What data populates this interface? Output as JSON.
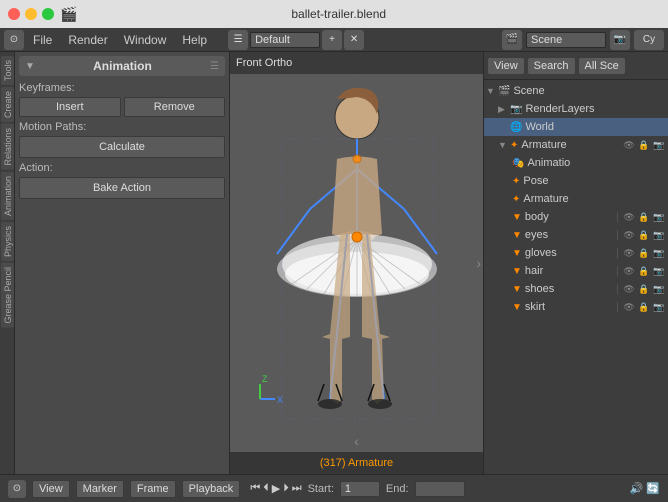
{
  "titlebar": {
    "title": "ballet-trailer.blend",
    "icon": "🎬"
  },
  "menubar": {
    "items": [
      "File",
      "Render",
      "Window",
      "Help"
    ],
    "workspace": "Default",
    "scene": "Scene",
    "cy_label": "Cy"
  },
  "panel": {
    "title": "Animation",
    "keyframes_label": "Keyframes:",
    "insert_btn": "Insert",
    "remove_btn": "Remove",
    "motion_paths_label": "Motion Paths:",
    "calculate_btn": "Calculate",
    "action_label": "Action:",
    "bake_action_btn": "Bake Action"
  },
  "viewport": {
    "header": "Front Ortho",
    "footer": "(317) Armature"
  },
  "outliner": {
    "tabs": [
      "View",
      "Search",
      "All Sce"
    ],
    "scene_label": "Scene",
    "items": [
      {
        "indent": 0,
        "icon": "🎬",
        "label": "Scene",
        "has_arrow": true,
        "depth": 0
      },
      {
        "indent": 1,
        "icon": "📷",
        "label": "RenderLayers",
        "has_arrow": false,
        "depth": 1
      },
      {
        "indent": 1,
        "icon": "🌐",
        "label": "World",
        "has_arrow": false,
        "depth": 1,
        "selected": true
      },
      {
        "indent": 1,
        "icon": "🦴",
        "label": "Armature",
        "has_arrow": true,
        "depth": 1,
        "has_eye": true,
        "has_lock": true,
        "has_render": true
      },
      {
        "indent": 2,
        "icon": "🎭",
        "label": "Animatio",
        "has_arrow": false,
        "depth": 2
      },
      {
        "indent": 2,
        "icon": "🦴",
        "label": "Pose",
        "has_arrow": false,
        "depth": 2
      },
      {
        "indent": 2,
        "icon": "🦴",
        "label": "Armature",
        "has_arrow": false,
        "depth": 2
      },
      {
        "indent": 2,
        "icon": "▼",
        "label": "body",
        "has_arrow": false,
        "depth": 2,
        "has_eye": true,
        "has_lock": true,
        "has_render": true
      },
      {
        "indent": 2,
        "icon": "▼",
        "label": "eyes",
        "has_arrow": false,
        "depth": 2,
        "has_eye": true,
        "has_lock": true,
        "has_render": true
      },
      {
        "indent": 2,
        "icon": "▼",
        "label": "gloves",
        "has_arrow": false,
        "depth": 2,
        "has_eye": true,
        "has_lock": true,
        "has_render": true
      },
      {
        "indent": 2,
        "icon": "▼",
        "label": "hair",
        "has_arrow": false,
        "depth": 2,
        "has_eye": true,
        "has_lock": true,
        "has_render": true
      },
      {
        "indent": 2,
        "icon": "▼",
        "label": "shoes",
        "has_arrow": false,
        "depth": 2,
        "has_eye": true,
        "has_lock": true,
        "has_render": true
      },
      {
        "indent": 2,
        "icon": "▼",
        "label": "skirt",
        "has_arrow": false,
        "depth": 2,
        "has_eye": true,
        "has_lock": true,
        "has_render": true
      }
    ]
  },
  "bottombar": {
    "view_btn": "View",
    "marker_btn": "Marker",
    "frame_btn": "Frame",
    "playback_btn": "Playback",
    "start_label": "Start:",
    "start_val": "1",
    "end_label": "End:",
    "end_val": ""
  },
  "side_tabs": [
    "Tools",
    "Create",
    "Relations",
    "Animation",
    "Physics",
    "Grease Pencil"
  ]
}
